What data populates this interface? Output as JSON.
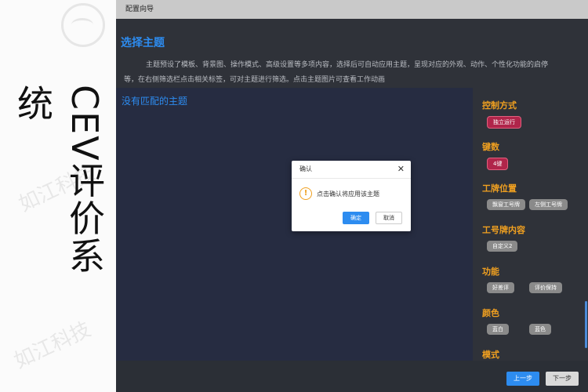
{
  "brand": {
    "vertical_title": "CEV评价系统",
    "watermark": "如江科技"
  },
  "window": {
    "title": "配置向导"
  },
  "header": {
    "page_title": "选择主题",
    "description": "主题预设了模板、背景图、操作模式、高级设置等多项内容，选择后可自动应用主题，呈现对应的外观、动作、个性化功能的启停等，在右侧筛选栏点击相关标签，可对主题进行筛选。点击主题图片可查看工作动画"
  },
  "content": {
    "empty_message": "没有匹配的主题"
  },
  "filters": {
    "control_mode": {
      "title": "控制方式",
      "tags": [
        "独立运行"
      ]
    },
    "keys": {
      "title": "键数",
      "tags": [
        "4键"
      ]
    },
    "badge_position": {
      "title": "工牌位置",
      "tags": [
        "飘窗工号牌",
        "左侧工号牌"
      ]
    },
    "badge_content": {
      "title": "工号牌内容",
      "tags": [
        "自定义2"
      ]
    },
    "function": {
      "title": "功能",
      "tags": [
        "好差评",
        "评价保持"
      ]
    },
    "color": {
      "title": "颜色",
      "tags": [
        "蓝白",
        "蓝色"
      ]
    },
    "mode": {
      "title": "模式"
    }
  },
  "footer": {
    "prev_label": "上一步",
    "next_label": "下一步"
  },
  "dialog": {
    "title": "确认",
    "close_glyph": "✕",
    "icon_glyph": "!",
    "message": "点击确认将应用该主题",
    "ok_label": "确定",
    "cancel_label": "取消"
  },
  "colors": {
    "accent_blue": "#2d8cf0",
    "group_title_orange": "#f0a020",
    "tag_selected": "#b0254a",
    "tag_unselected": "#8a8a8a"
  }
}
